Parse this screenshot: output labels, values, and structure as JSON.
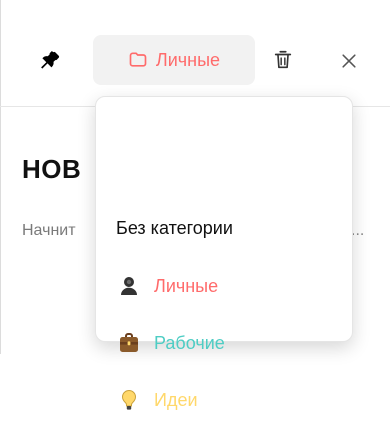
{
  "toolbar": {
    "pin_icon": "pin-icon",
    "category_button": {
      "label": "Личные",
      "icon": "folder-icon",
      "color": "#ff6b6b"
    },
    "trash_icon": "trash-icon",
    "close_icon": "close-icon"
  },
  "note": {
    "title": "НОВ",
    "body_preview": "Начнит",
    "overflow": "..."
  },
  "category_menu": {
    "items": [
      {
        "label": "Без категории",
        "color": "#111111",
        "icon": ""
      },
      {
        "label": "Личные",
        "color": "#ff6b6b",
        "icon": "person-icon"
      },
      {
        "label": "Рабочие",
        "color": "#4ecdc4",
        "icon": "briefcase-icon"
      },
      {
        "label": "Идеи",
        "color": "#ffd86b",
        "icon": "lightbulb-icon"
      }
    ]
  }
}
